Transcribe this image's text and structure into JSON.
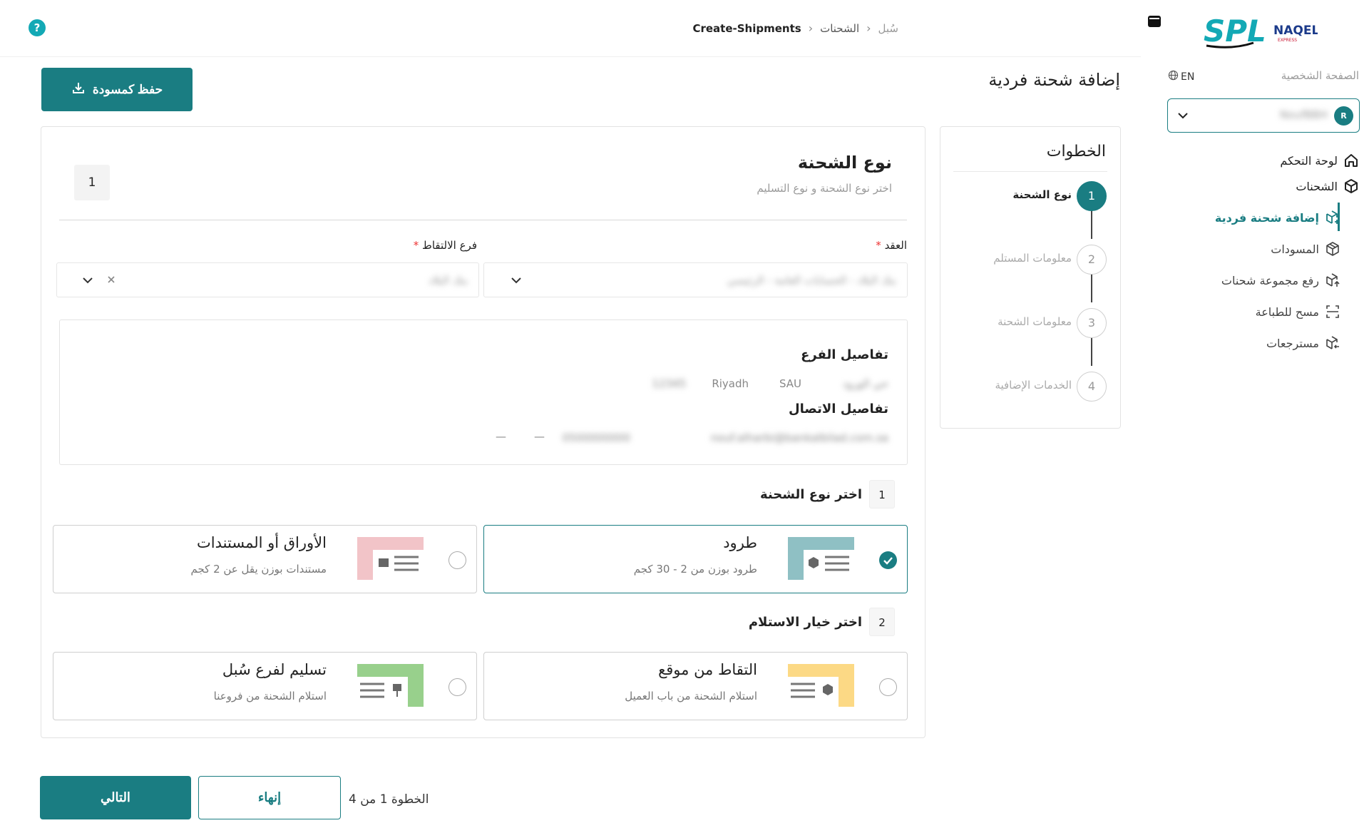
{
  "header": {
    "breadcrumb": [
      "سُبل",
      "الشحنات",
      "Create-Shipments"
    ],
    "help": "?"
  },
  "sidebar": {
    "logo_primary": "SPL",
    "logo_secondary": "NAQEL",
    "logo_sub": "EXPRESS",
    "lang": "EN",
    "profile_link": "الصفحة الشخصية",
    "account_initial": "R",
    "account_name": "NoufBBH",
    "items": [
      {
        "label": "لوحة التحكم",
        "icon": "home-icon"
      },
      {
        "label": "الشحنات",
        "icon": "package-icon"
      },
      {
        "label": "إضافة شحنة فردية",
        "icon": "package-add-icon",
        "active": true
      },
      {
        "label": "المسودات",
        "icon": "package-draft-icon"
      },
      {
        "label": "رفع مجموعة شحنات",
        "icon": "package-upload-icon"
      },
      {
        "label": "مسح للطباعة",
        "icon": "scan-icon"
      },
      {
        "label": "مسترجعات",
        "icon": "return-icon"
      }
    ]
  },
  "page": {
    "title": "إضافة شحنة فردية",
    "save_draft": "حفظ كمسودة"
  },
  "steps": {
    "title": "الخطوات",
    "items": [
      {
        "num": "1",
        "label": "نوع الشحنة"
      },
      {
        "num": "2",
        "label": "معلومات المستلم"
      },
      {
        "num": "3",
        "label": "معلومات الشحنة"
      },
      {
        "num": "4",
        "label": "الخدمات الإضافية"
      }
    ]
  },
  "form": {
    "section_title": "نوع الشحنة",
    "section_subtitle": "اختر نوع الشحنة و نوع التسليم",
    "section_number": "1",
    "contract_label": "العقد",
    "contract_value": "بنك البلاد - الحسابات العامة - الرئيسي",
    "branch_label": "فرع الالتقاط",
    "branch_value": "بنك البلاد",
    "required_mark": "*",
    "branch_details_title": "تفاصيل الفرع",
    "branch_district": "حي الورود",
    "branch_city": "Riyadh",
    "branch_country": "SAU",
    "branch_zip": "12345",
    "contact_title": "تفاصيل الاتصال",
    "contact_email": "nouf.alharbi@bankalbilad.com.sa",
    "contact_phone": "0500000000",
    "contact_dash1": "—",
    "contact_dash2": "—",
    "q1_num": "1",
    "q1_title": "اختر نوع الشحنة",
    "q2_num": "2",
    "q2_title": "اختر خيار الاستلام",
    "options": {
      "parcels_title": "طرود",
      "parcels_sub": "طرود بوزن من 2 - 30 كجم",
      "docs_title": "الأوراق أو المستندات",
      "docs_sub": "مستندات بوزن يقل عن 2 كجم",
      "pickup_title": "التقاط من موقع",
      "pickup_sub": "استلام الشحنة من باب العميل",
      "branch_title": "تسليم لفرع سُبل",
      "branch_sub": "استلام الشحنة من فروعنا"
    }
  },
  "footer": {
    "next": "التالي",
    "finish": "إنهاء",
    "step_of": "الخطوة 1 من 4"
  },
  "colors": {
    "primary": "#1a7d82",
    "help": "#13a9b5",
    "required": "#e33333"
  }
}
